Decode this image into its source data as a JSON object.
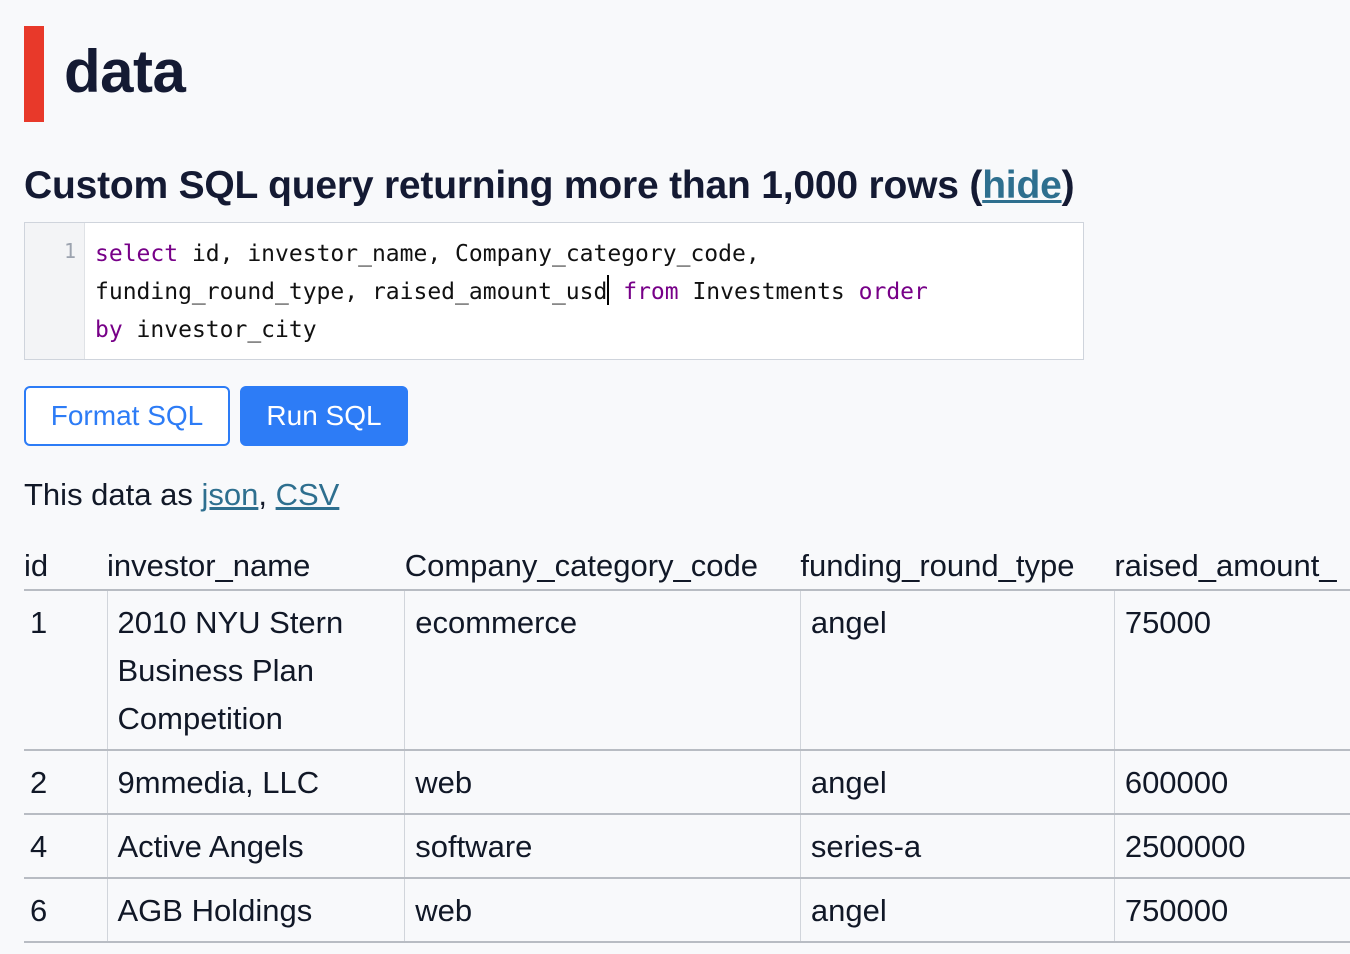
{
  "page": {
    "title": "data"
  },
  "query": {
    "heading_text": "Custom SQL query returning more than 1,000 rows (",
    "hide_link": "hide",
    "heading_close": ")",
    "line_number": "1",
    "line1_kw": "select",
    "line1_rest": " id, investor_name, Company_category_code,",
    "line2_a": "funding_round_type, raised_amount_usd",
    "line2_kw1": "from",
    "line2_mid": " Investments ",
    "line2_kw2": "order",
    "line3_kw": "by",
    "line3_rest": " investor_city"
  },
  "buttons": {
    "format_label": "Format SQL",
    "run_label": "Run SQL"
  },
  "export": {
    "prefix": "This data as ",
    "json_label": "json",
    "separator": ", ",
    "csv_label": "CSV"
  },
  "table": {
    "columns": [
      "id",
      "investor_name",
      "Company_category_code",
      "funding_round_type",
      "raised_amount_"
    ],
    "rows": [
      {
        "id": "1",
        "investor_name": "2010 NYU Stern Business Plan Competition",
        "category": "ecommerce",
        "round": "angel",
        "amount": "75000"
      },
      {
        "id": "2",
        "investor_name": "9mmedia, LLC",
        "category": "web",
        "round": "angel",
        "amount": "600000"
      },
      {
        "id": "4",
        "investor_name": "Active Angels",
        "category": "software",
        "round": "series-a",
        "amount": "2500000"
      },
      {
        "id": "6",
        "investor_name": "AGB Holdings",
        "category": "web",
        "round": "angel",
        "amount": "750000"
      }
    ]
  },
  "colors": {
    "accent": "#e8392a",
    "button": "#2d7cf6",
    "link": "#2e6f8f",
    "sql_keyword": "#770088"
  }
}
